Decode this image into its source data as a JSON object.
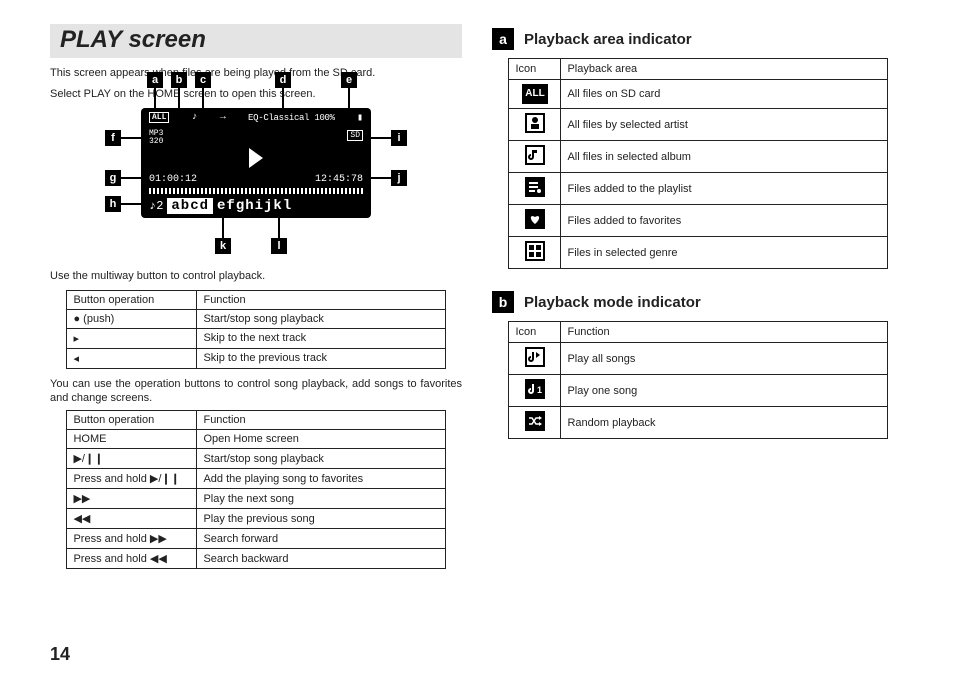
{
  "page_number": "14",
  "heading": "PLAY screen",
  "intro_l1": "This screen appears when files are being played from the SD card.",
  "intro_l2": "Select PLAY on the HOME screen to open this screen.",
  "diagram": {
    "all": "ALL",
    "eq": "EQ-Classical 100%",
    "fmt": "MP3",
    "br": "320",
    "sd": "SD",
    "t1": "01:00:12",
    "t2": "12:45:78",
    "title_a": "abcd",
    "title_b": "efghijkl",
    "callouts": {
      "a": "a",
      "b": "b",
      "c": "c",
      "d": "d",
      "e": "e",
      "f": "f",
      "g": "g",
      "h": "h",
      "i": "i",
      "j": "j",
      "k": "k",
      "l": "l"
    }
  },
  "multiline_caption": "Use the multiway button to control playback.",
  "multiway_table": {
    "h1": "Button operation",
    "h2": "Function",
    "r1a": "● (push)",
    "r1b": "Start/stop song playback",
    "r2a": "▸",
    "r2b": "Skip to the next track",
    "r3a": "◂",
    "r3b": "Skip to the previous track"
  },
  "ops_caption": "You can use the operation buttons to control song playback, add songs to favorites and change screens.",
  "ops_table": {
    "h1": "Button operation",
    "h2": "Function",
    "r1a": "HOME",
    "r1b": "Open Home screen",
    "r2a": "▶/❙❙",
    "r2b": "Start/stop song playback",
    "r3a": "Press and hold ▶/❙❙",
    "r3b": "Add the playing song to favorites",
    "r4a": "▶▶",
    "r4b": "Play the next song",
    "r5a": "◀◀",
    "r5b": "Play the previous song",
    "r6a": "Press and hold ▶▶",
    "r6b": "Search forward",
    "r7a": "Press and hold ◀◀",
    "r7b": "Search backward"
  },
  "sec_a_title": "Playback area indicator",
  "area_table": {
    "h1": "Icon",
    "h2": "Playback area",
    "r1": "All files on SD card",
    "r2": "All files by selected artist",
    "r3": "All files in selected album",
    "r4": "Files added to the playlist",
    "r5": "Files added to favorites",
    "r6": "Files in selected genre"
  },
  "sec_b_title": "Playback mode indicator",
  "mode_table": {
    "h1": "Icon",
    "h2": "Function",
    "r1": "Play all songs",
    "r2": "Play one song",
    "r3": "Random playback"
  }
}
